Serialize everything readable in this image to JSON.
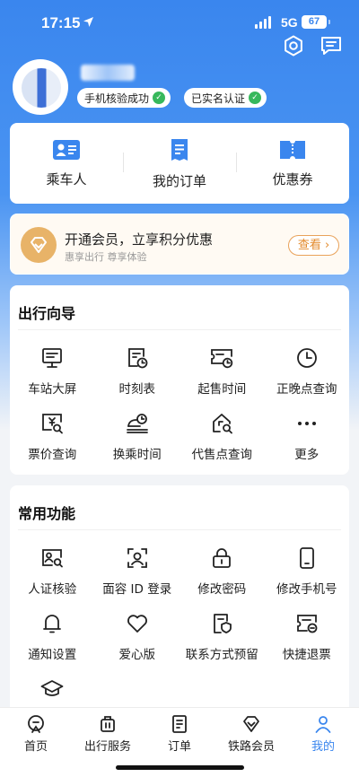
{
  "status_bar": {
    "time": "17:15",
    "network": "5G",
    "battery": "67"
  },
  "header": {
    "icons": [
      "settings-icon",
      "message-icon"
    ]
  },
  "profile": {
    "badges": [
      {
        "label": "手机核验成功",
        "icon": "check-icon"
      },
      {
        "label": "已实名认证",
        "icon": "check-icon"
      }
    ]
  },
  "quick_links": [
    {
      "label": "乘车人",
      "icon": "passenger-card-icon"
    },
    {
      "label": "我的订单",
      "icon": "order-document-icon"
    },
    {
      "label": "优惠券",
      "icon": "coupon-icon"
    }
  ],
  "member": {
    "title": "开通会员，立享积分优惠",
    "subtitle": "惠享出行 尊享体验",
    "button": "查看"
  },
  "guide": {
    "title": "出行向导",
    "items": [
      {
        "label": "车站大屏",
        "icon": "screen-icon"
      },
      {
        "label": "时刻表",
        "icon": "timetable-icon"
      },
      {
        "label": "起售时间",
        "icon": "ticket-clock-icon"
      },
      {
        "label": "正晚点查询",
        "icon": "clock-icon"
      },
      {
        "label": "票价查询",
        "icon": "price-search-icon"
      },
      {
        "label": "换乘时间",
        "icon": "train-clock-icon"
      },
      {
        "label": "代售点查询",
        "icon": "house-search-icon"
      },
      {
        "label": "更多",
        "icon": "more-icon"
      }
    ]
  },
  "functions": {
    "title": "常用功能",
    "items": [
      {
        "label": "人证核验",
        "icon": "id-verify-icon"
      },
      {
        "label": "面容 ID 登录",
        "icon": "face-id-icon"
      },
      {
        "label": "修改密码",
        "icon": "lock-icon"
      },
      {
        "label": "修改手机号",
        "icon": "phone-icon"
      },
      {
        "label": "通知设置",
        "icon": "bell-icon"
      },
      {
        "label": "爱心版",
        "icon": "heart-icon"
      },
      {
        "label": "联系方式预留",
        "icon": "contact-shield-icon"
      },
      {
        "label": "快捷退票",
        "icon": "refund-ticket-icon"
      },
      {
        "label": "",
        "icon": "graduation-cap-icon"
      }
    ]
  },
  "tabs": [
    {
      "label": "首页",
      "icon": "home-train-icon",
      "active": false
    },
    {
      "label": "出行服务",
      "icon": "luggage-icon",
      "active": false
    },
    {
      "label": "订单",
      "icon": "order-icon",
      "active": false
    },
    {
      "label": "铁路会员",
      "icon": "diamond-icon",
      "active": false
    },
    {
      "label": "我的",
      "icon": "user-icon",
      "active": true
    }
  ],
  "colors": {
    "primary": "#3a86ee",
    "member_accent": "#e38a2c",
    "success": "#37b85c"
  }
}
